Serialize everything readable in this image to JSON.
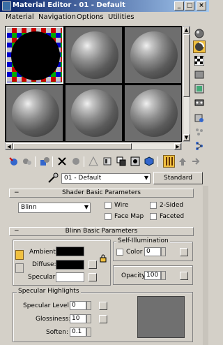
{
  "window": {
    "title": "Material Editor - 01 - Default",
    "controls": {
      "minimize": "_",
      "maximize": "□",
      "close": "×"
    },
    "colors": {
      "titlebar_start": "#0a246a",
      "titlebar_end": "#a6caf0"
    }
  },
  "menu": [
    {
      "label": "Material"
    },
    {
      "label": "Navigation"
    },
    {
      "label": "Options"
    },
    {
      "label": "Utilities"
    }
  ],
  "sample_slots": {
    "count": 6,
    "active_index": 0,
    "active_material": "01 - Default"
  },
  "right_toolbar": [
    "sample-type-sphere-icon",
    "backlight-icon",
    "background-checker-icon",
    "sample-uv-tiling-icon",
    "video-color-check-icon",
    "make-preview-icon",
    "options-icon",
    "select-by-material-icon",
    "material-map-navigator-icon"
  ],
  "bottom_toolbar": [
    "get-material-icon",
    "put-to-scene-icon",
    "assign-to-selection-icon",
    "reset-map-icon",
    "make-unique-icon",
    "put-to-library-icon",
    "material-effects-channel-icon",
    "show-map-in-viewport-icon",
    "show-end-result-icon",
    "go-to-parent-icon",
    "go-forward-to-sibling-icon"
  ],
  "material_name": {
    "value": "01 - Default",
    "type_button": "Standard"
  },
  "shader_basic": {
    "header": "Shader Basic Parameters",
    "collapse": "−",
    "shader": "Blinn",
    "options": {
      "wire": "Wire",
      "two_sided": "2-Sided",
      "face_map": "Face Map",
      "faceted": "Faceted"
    }
  },
  "blinn_basic": {
    "header": "Blinn Basic Parameters",
    "collapse": "−",
    "ambient_label": "Ambient:",
    "diffuse_label": "Diffuse:",
    "specular_label": "Specular:",
    "self_illum_title": "Self-Illumination",
    "color_label": "Color",
    "color_value": "0",
    "opacity_label": "Opacity:",
    "opacity_value": "100",
    "spec_highlights_title": "Specular Highlights",
    "spec_level_label": "Specular Level:",
    "spec_level_value": "0",
    "glossiness_label": "Glossiness:",
    "glossiness_value": "10",
    "soften_label": "Soften:",
    "soften_value": "0.1",
    "colors": {
      "ambient": "#000000",
      "diffuse": "#000000",
      "specular": "#ffffff",
      "highlight_preview": "#707070"
    }
  }
}
